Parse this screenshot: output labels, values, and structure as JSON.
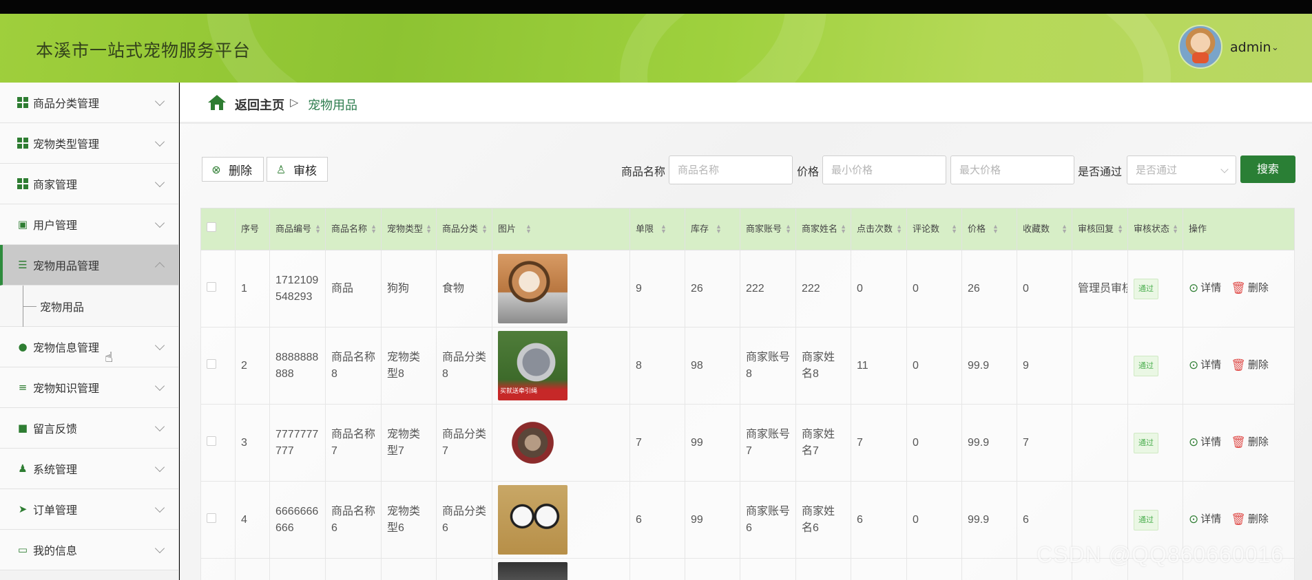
{
  "app": {
    "title": "本溪市一站式宠物服务平台",
    "user_name": "admin"
  },
  "sidebar": {
    "items": [
      {
        "label": "商品分类管理",
        "icon": "grid-icon"
      },
      {
        "label": "宠物类型管理",
        "icon": "grid-icon"
      },
      {
        "label": "商家管理",
        "icon": "grid-icon"
      },
      {
        "label": "用户管理",
        "icon": "clipboard-icon"
      },
      {
        "label": "宠物用品管理",
        "icon": "list-icon",
        "active": true
      },
      {
        "label": "宠物信息管理",
        "icon": "balloon-icon"
      },
      {
        "label": "宠物知识管理",
        "icon": "sliders-icon"
      },
      {
        "label": "留言反馈",
        "icon": "briefcase-icon"
      },
      {
        "label": "系统管理",
        "icon": "person-icon"
      },
      {
        "label": "订单管理",
        "icon": "paper-plane-icon"
      },
      {
        "label": "我的信息",
        "icon": "card-icon"
      }
    ],
    "submenu_label": "宠物用品"
  },
  "breadcrumb": {
    "home": "返回主页",
    "separator": "▷",
    "current": "宠物用品"
  },
  "toolbar": {
    "delete_label": "删除",
    "audit_label": "审核"
  },
  "search": {
    "name_label": "商品名称",
    "name_placeholder": "商品名称",
    "price_label": "价格",
    "min_price_placeholder": "最小价格",
    "max_price_placeholder": "最大价格",
    "approved_label": "是否通过",
    "approved_placeholder": "是否通过",
    "search_button": "搜索"
  },
  "table": {
    "headers": [
      "序号",
      "商品编号",
      "商品名称",
      "宠物类型",
      "商品分类",
      "图片",
      "单限",
      "库存",
      "商家账号",
      "商家姓名",
      "点击次数",
      "评论数",
      "价格",
      "收藏数",
      "审核回复",
      "审核状态",
      "操作"
    ],
    "rows": [
      {
        "no": "1",
        "code": "1712109548293",
        "name": "商品",
        "pet_type": "狗狗",
        "category": "食物",
        "limit": "9",
        "stock": "26",
        "merchant_account": "222",
        "merchant_name": "222",
        "clicks": "0",
        "comments": "0",
        "price": "26",
        "favorites": "0",
        "reply": "管理员审核",
        "status": "通过"
      },
      {
        "no": "2",
        "code": "8888888888",
        "name": "商品名称8",
        "pet_type": "宠物类型8",
        "category": "商品分类8",
        "limit": "8",
        "stock": "98",
        "merchant_account": "商家账号8",
        "merchant_name": "商家姓名8",
        "clicks": "11",
        "comments": "0",
        "price": "99.9",
        "favorites": "9",
        "reply": "",
        "status": "通过"
      },
      {
        "no": "3",
        "code": "7777777777",
        "name": "商品名称7",
        "pet_type": "宠物类型7",
        "category": "商品分类7",
        "limit": "7",
        "stock": "99",
        "merchant_account": "商家账号7",
        "merchant_name": "商家姓名7",
        "clicks": "7",
        "comments": "0",
        "price": "99.9",
        "favorites": "7",
        "reply": "",
        "status": "通过"
      },
      {
        "no": "4",
        "code": "6666666666",
        "name": "商品名称6",
        "pet_type": "宠物类型6",
        "category": "商品分类6",
        "limit": "6",
        "stock": "99",
        "merchant_account": "商家账号6",
        "merchant_name": "商家姓名6",
        "clicks": "6",
        "comments": "0",
        "price": "99.9",
        "favorites": "6",
        "reply": "",
        "status": "通过"
      }
    ],
    "detail_label": "详情",
    "delete_label": "删除",
    "image_2_caption": "买就送牵引绳"
  },
  "watermark": "CSDN @QQ860660016",
  "colors": {
    "primary_green": "#2a7f35",
    "header_green": "#8dc332",
    "table_header": "#d7eec7",
    "active_menu": "#c9c9c9"
  }
}
